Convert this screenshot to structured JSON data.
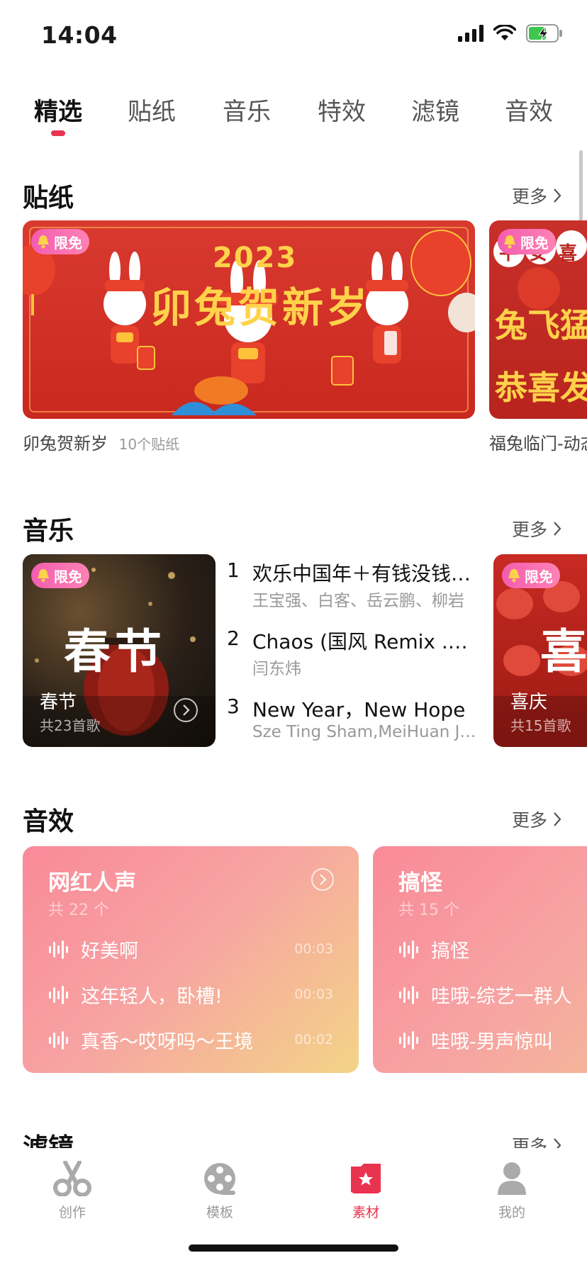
{
  "status": {
    "time": "14:04"
  },
  "tabs": [
    {
      "label": "精选"
    },
    {
      "label": "贴纸"
    },
    {
      "label": "音乐"
    },
    {
      "label": "特效"
    },
    {
      "label": "滤镜"
    },
    {
      "label": "音效"
    }
  ],
  "sections": {
    "stickers": {
      "title": "贴纸",
      "more": "更多",
      "badge": "限免",
      "cards": [
        {
          "banner_year": "2023",
          "banner_title": "卯兔贺新岁",
          "name": "卯兔贺新岁",
          "count": "10个贴纸"
        },
        {
          "banner_chars": "平安喜",
          "banner_title1": "兔飞猛",
          "banner_title2": "恭喜发",
          "name": "福兔临门-动态"
        }
      ]
    },
    "music": {
      "title": "音乐",
      "more": "更多",
      "badge": "限免",
      "playlists": [
        {
          "cover_text": "春节",
          "name": "春节",
          "count": "共23首歌"
        },
        {
          "cover_text": "喜",
          "name": "喜庆",
          "count": "共15首歌"
        }
      ],
      "songs": [
        {
          "num": "1",
          "title": "欢乐中国年＋有钱没钱回家过年",
          "artist": "王宝强、白客、岳云鹏、柳岩"
        },
        {
          "num": "2",
          "title": "Chaos (国风 Remix .徐梦圆)",
          "artist": "闫东炜"
        },
        {
          "num": "3",
          "title": "New Year，New Hope",
          "artist": "Sze Ting Sham,MeiHuan Jiang"
        }
      ]
    },
    "sfx": {
      "title": "音效",
      "more": "更多",
      "cards": [
        {
          "name": "网红人声",
          "count": "共 22 个",
          "items": [
            {
              "label": "好美啊",
              "duration": "00:03"
            },
            {
              "label": "这年轻人，卧槽!",
              "duration": "00:03"
            },
            {
              "label": "真香～哎呀吗～王境",
              "duration": "00:02"
            }
          ]
        },
        {
          "name": "搞怪",
          "count": "共 15 个",
          "items": [
            {
              "label": "搞怪"
            },
            {
              "label": "哇哦-综艺一群人"
            },
            {
              "label": "哇哦-男声惊叫"
            }
          ]
        }
      ]
    },
    "filters": {
      "title": "滤镜",
      "more": "更多"
    }
  },
  "bottom_nav": [
    {
      "label": "创作",
      "icon": "scissors-icon"
    },
    {
      "label": "模板",
      "icon": "film-reel-icon"
    },
    {
      "label": "素材",
      "icon": "folder-star-icon",
      "active": true
    },
    {
      "label": "我的",
      "icon": "person-icon"
    }
  ],
  "colors": {
    "accent": "#e8344e",
    "badge": "#f25daf",
    "banner_red": "#d93a2f",
    "banner_gold": "#ffd24a"
  }
}
